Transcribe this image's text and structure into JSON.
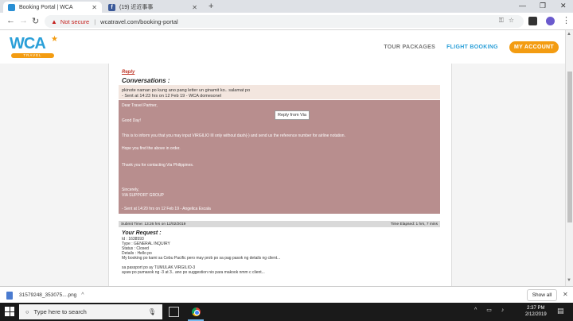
{
  "browser": {
    "tabs": [
      {
        "title": "Booking Portal | WCA",
        "favicon": "wca-favicon"
      },
      {
        "title": "(19) 近近事事",
        "favicon": "facebook-favicon"
      }
    ],
    "new_tab": "+",
    "window_controls": [
      "—",
      "❐",
      "✕"
    ],
    "address": {
      "security_label": "Not secure",
      "separator": "|",
      "url": "wcatravel.com/booking-portal"
    },
    "nav": {
      "back": "←",
      "forward": "→",
      "reload": "C"
    }
  },
  "site": {
    "logo_text": "WCA",
    "logo_sub": "TRAVEL",
    "nav": {
      "tour_packages": "TOUR PACKAGES",
      "flight_booking": "FLIGHT BOOKING",
      "my_account": "MY ACCOUNT"
    },
    "colors": {
      "brand_blue": "#2a9fd8",
      "brand_orange": "#f39c12",
      "message_bg": "#b88e8e"
    }
  },
  "ticket": {
    "reply_link": "Reply",
    "conversations_title": "Conversations :",
    "message1": {
      "text": "pkinote naman po kung ano pang letter un ginamit ko.. salamat po",
      "meta": "- Sent at 14:23 hrs on 12 Feb 19 - WCA domesonel"
    },
    "message2": {
      "greeting": "Dear Travel Partner,",
      "good_day": "Good Day!",
      "body": "This is to inform you that you may input VIRGILIO III only without dash(-) and send us the reference number for airline notation.",
      "hope": "Hope you find the above in order.",
      "thanks": "Thank you for contacting Via Philippines.",
      "sincerely": "Sincerely,",
      "group": "VIA SUPPORT GROUP",
      "meta": "- Sent at 14:20 hrs on 12 Feb 19 - Angelica Escala",
      "reply_button": "Reply from Via"
    },
    "submit_time": "Submit Time: 13:26 hrs on 12/02/2019",
    "time_elapsed": "Time Elapsed: 1 hrs, 7 mins",
    "request": {
      "title": "Your Request :",
      "id": "Id : 1638593",
      "type": "Type : GENERAL INQUIRY",
      "status": "Status : Closed",
      "details": "Details : Hello po",
      "line1": "My booking po kami sa Cebu Pacific pero may prob po sa pag pasok ng details ng client...",
      "line2": "sa passport po ay TUMULAK VIRGILIO-3",
      "line3": "ayaw po pumasok ng -3 at 3.. ano po suggestion nio para makook nmm c client..."
    }
  },
  "downloads": {
    "file": "31579248_353075....png",
    "caret": "^",
    "show_all": "Show all",
    "close": "✕"
  },
  "taskbar": {
    "search_placeholder": "Type here to search",
    "time": "2:37 PM",
    "date": "2/12/2019"
  }
}
